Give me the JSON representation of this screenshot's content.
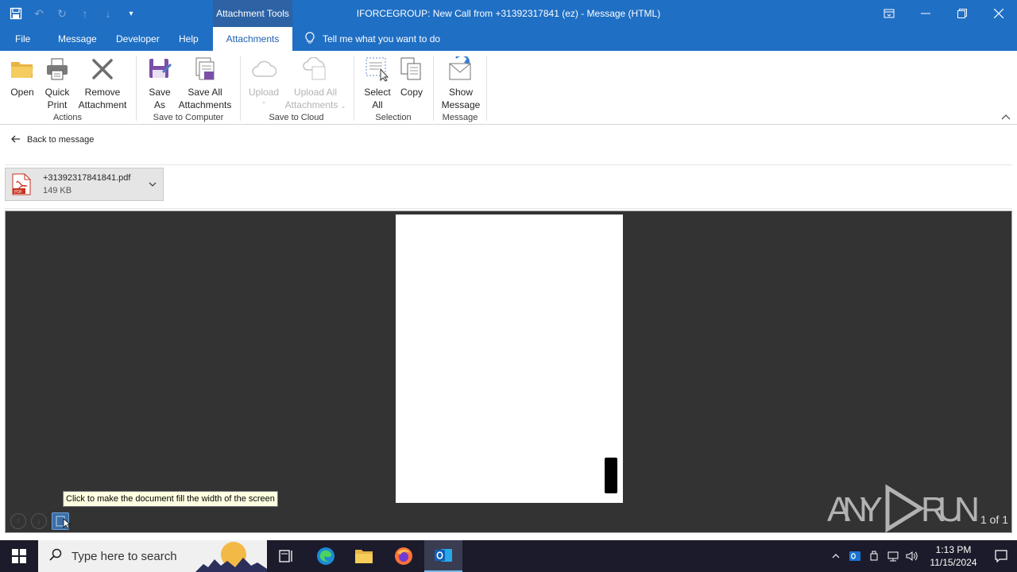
{
  "titlebar": {
    "context_tab": "Attachment Tools",
    "title": "IFORCEGROUP: New Call from +31392317841 (ez)  -  Message (HTML)"
  },
  "tabs": [
    "File",
    "Message",
    "Developer",
    "Help",
    "Attachments"
  ],
  "tell_me": "Tell me what you want to do",
  "ribbon": {
    "groups": {
      "actions": "Actions",
      "save_computer": "Save to Computer",
      "save_cloud": "Save to Cloud",
      "selection": "Selection",
      "message": "Message"
    },
    "buttons": {
      "open": "Open",
      "quick_print_1": "Quick",
      "quick_print_2": "Print",
      "remove_1": "Remove",
      "remove_2": "Attachment",
      "save_as_1": "Save",
      "save_as_2": "As",
      "save_all_1": "Save All",
      "save_all_2": "Attachments",
      "upload": "Upload",
      "upload_all_1": "Upload All",
      "upload_all_2": "Attachments",
      "select_all_1": "Select",
      "select_all_2": "All",
      "copy": "Copy",
      "show_message_1": "Show",
      "show_message_2": "Message"
    }
  },
  "back_link": "Back to message",
  "attachment": {
    "name": "+31392317841841.pdf",
    "size": "149 KB"
  },
  "preview": {
    "tooltip": "Click to make the document fill the width of the screen",
    "page_indicator": "1 of 1",
    "watermark": "ANY RUN"
  },
  "taskbar": {
    "search_placeholder": "Type here to search",
    "time": "1:13 PM",
    "date": "11/15/2024"
  },
  "colors": {
    "accent": "#1f6fc4",
    "context_tab": "#2d63a5",
    "preview_bg": "#333333",
    "taskbar": "#1b1b2b"
  }
}
